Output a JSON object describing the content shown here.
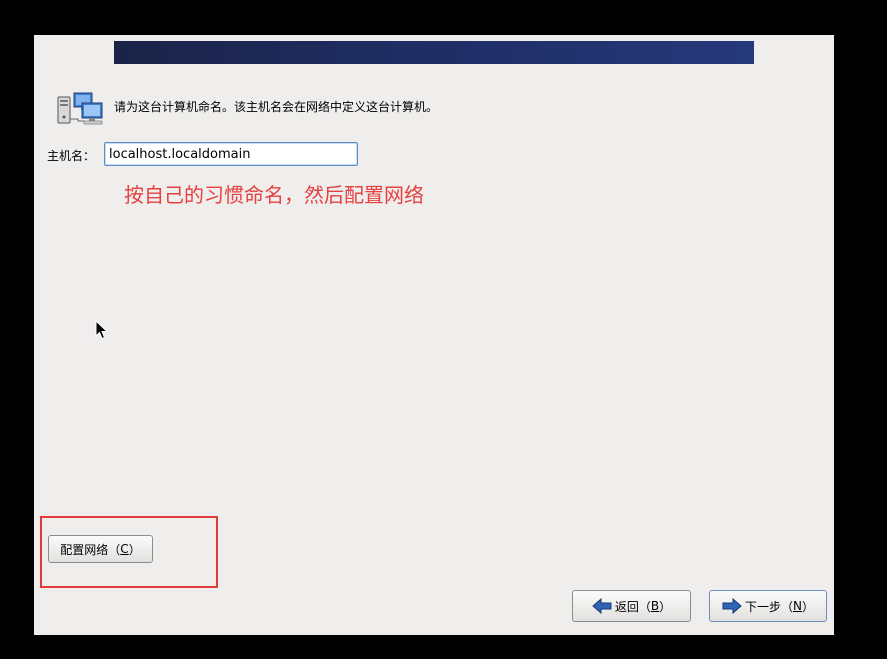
{
  "prompt": "请为这台计算机命名。该主机名会在网络中定义这台计算机。",
  "hostname": {
    "label": "主机名：",
    "value": "localhost.localdomain"
  },
  "annotation": "按自己的习惯命名，然后配置网络",
  "buttons": {
    "configure_network": {
      "text": "配置网络（",
      "key": "C",
      "suffix": "）"
    },
    "back": {
      "text": "返回（",
      "key": "B",
      "suffix": "）"
    },
    "next": {
      "text": "下一步（",
      "key": "N",
      "suffix": "）"
    }
  },
  "colors": {
    "annotation": "#e64040",
    "highlight": "#e53a3a",
    "banner": "#1f2d63",
    "arrow": "#2f64b5"
  },
  "icons": {
    "header": "network-computers-icon",
    "back": "arrow-left-icon",
    "next": "arrow-right-icon"
  }
}
